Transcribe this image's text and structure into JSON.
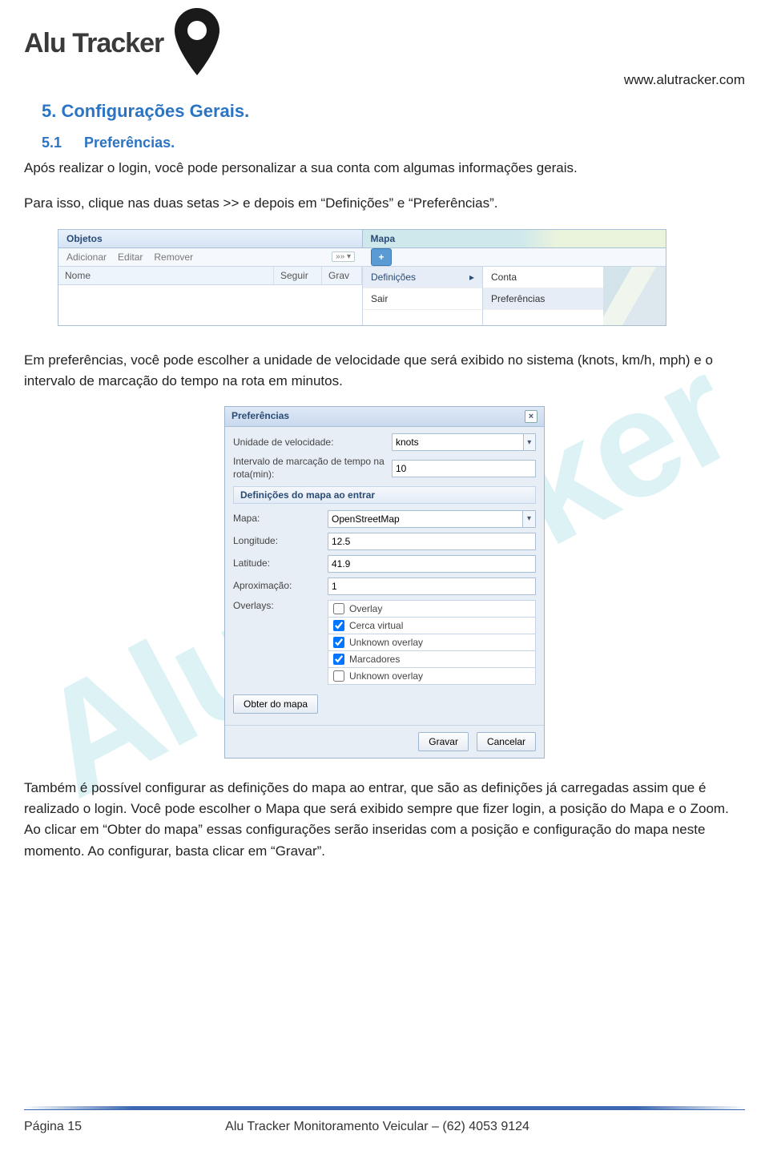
{
  "header": {
    "brand": "Alu Tracker",
    "site_url": "www.alutracker.com"
  },
  "doc": {
    "h1": "5.  Configurações Gerais.",
    "h2_num": "5.1",
    "h2_title": "Preferências.",
    "p1": "Após realizar o login, você pode personalizar a sua conta com algumas informações gerais.",
    "p2": "Para isso, clique nas duas setas >> e depois em “Definições” e “Preferências”.",
    "p3": "Em preferências, você pode escolher a unidade de velocidade que será exibido no sistema (knots, km/h, mph) e o intervalo de marcação do tempo na rota em minutos.",
    "p4": "Também é possível configurar as definições do mapa ao entrar, que são as definições já carregadas assim que é realizado o login. Você pode escolher o Mapa que será exibido sempre que fizer login, a posição do Mapa e o Zoom. Ao clicar em “Obter do mapa” essas configurações serão inseridas com a posição e configuração do mapa neste momento. Ao configurar, basta clicar em “Gravar”."
  },
  "shot1": {
    "tabs": {
      "objetos": "Objetos",
      "mapa": "Mapa"
    },
    "toolbar": {
      "adicionar": "Adicionar",
      "editar": "Editar",
      "remover": "Remover",
      "arrows": "»» ▾",
      "plus": "+"
    },
    "cols": {
      "nome": "Nome",
      "seguir": "Seguir",
      "grav": "Grav"
    },
    "menu": {
      "definicoes": "Definições",
      "sair": "Sair",
      "chevron": "▸"
    },
    "submenu": {
      "conta": "Conta",
      "preferencias": "Preferências"
    }
  },
  "dlg": {
    "title": "Preferências",
    "close": "×",
    "labels": {
      "unidade": "Unidade de velocidade:",
      "intervalo": "Intervalo de marcação de tempo na rota(min):",
      "section": "Definições do mapa ao entrar",
      "mapa": "Mapa:",
      "longitude": "Longitude:",
      "latitude": "Latitude:",
      "aproximacao": "Aproximação:",
      "overlays": "Overlays:"
    },
    "values": {
      "unidade": "knots",
      "intervalo": "10",
      "mapa": "OpenStreetMap",
      "longitude": "12.5",
      "latitude": "41.9",
      "aproximacao": "1"
    },
    "overlays": [
      {
        "label": "Overlay",
        "checked": false
      },
      {
        "label": "Cerca virtual",
        "checked": true
      },
      {
        "label": "Unknown overlay",
        "checked": true
      },
      {
        "label": "Marcadores",
        "checked": true
      },
      {
        "label": "Unknown overlay",
        "checked": false
      }
    ],
    "buttons": {
      "obter": "Obter do mapa",
      "gravar": "Gravar",
      "cancelar": "Cancelar"
    }
  },
  "footer": {
    "page": "Página 15",
    "center": "Alu Tracker Monitoramento Veicular – (62) 4053 9124"
  },
  "watermark": "AluTracker"
}
